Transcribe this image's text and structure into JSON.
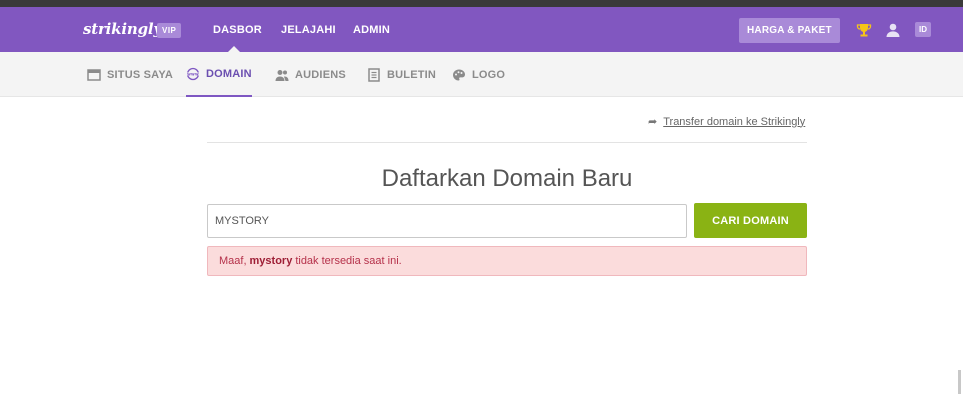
{
  "brand": {
    "logo": "strikingly",
    "badge": "VIP"
  },
  "nav": {
    "items": [
      "DASBOR",
      "JELAJAHI",
      "ADMIN"
    ],
    "pricing_label": "HARGA & PAKET",
    "lang_label": "ID"
  },
  "subnav": {
    "items": [
      "SITUS SAYA",
      "DOMAIN",
      "AUDIENS",
      "BULETIN",
      "LOGO"
    ],
    "active": "DOMAIN"
  },
  "main": {
    "transfer_link": "Transfer domain ke Strikingly",
    "title": "Daftarkan Domain Baru",
    "input_value": "MYSTORY",
    "search_button": "CARI DOMAIN",
    "alert": {
      "prefix": "Maaf,",
      "domain": "mystory",
      "suffix": "tidak tersedia saat ini."
    }
  },
  "colors": {
    "topbar": "#8157c0",
    "accent": "#7e57c2",
    "button_green": "#8ab314",
    "alert_bg": "#fbdcdc",
    "alert_text": "#b5314a"
  }
}
